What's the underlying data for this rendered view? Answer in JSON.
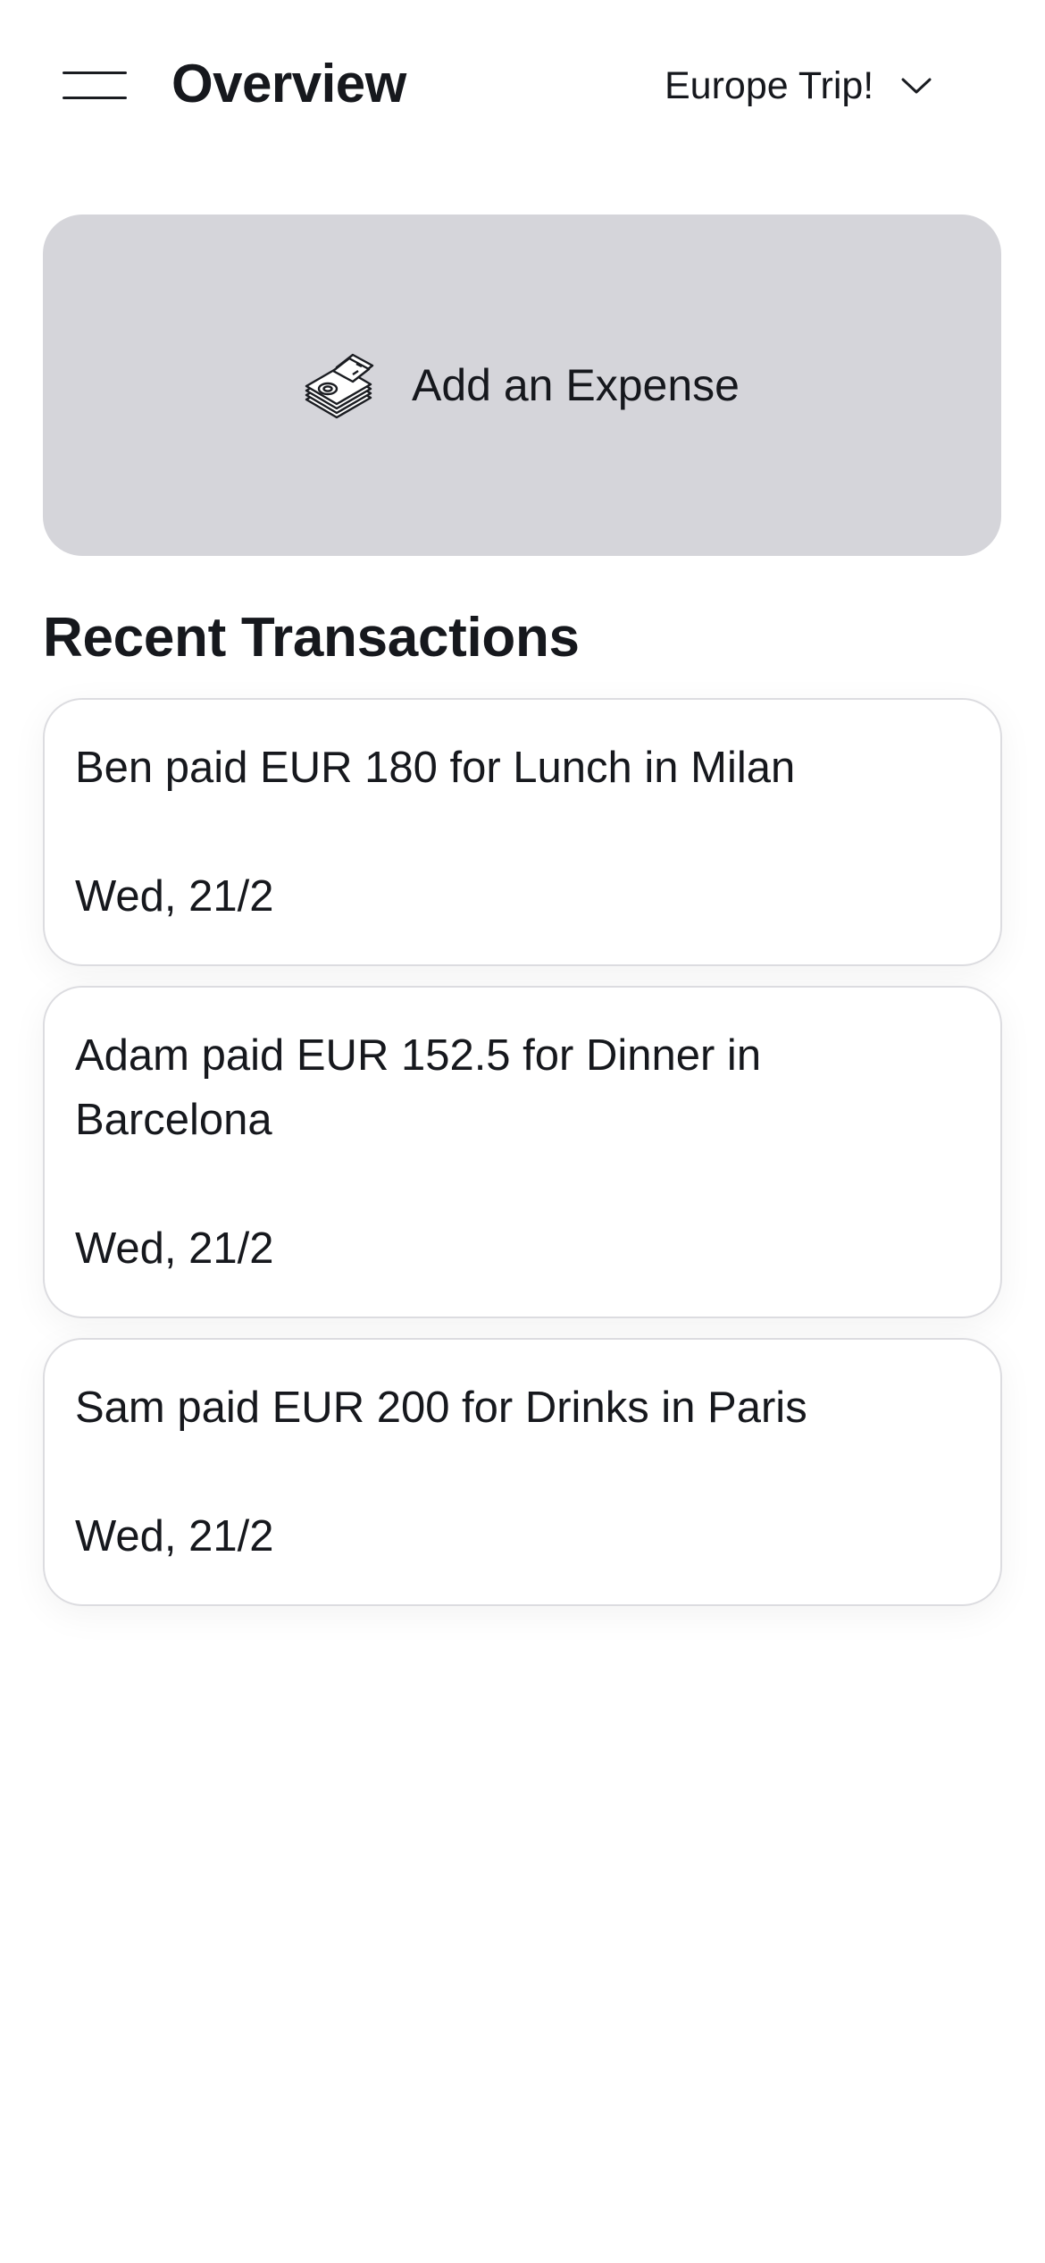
{
  "header": {
    "title": "Overview",
    "trip_selector": {
      "selected": "Europe Trip!"
    },
    "icons": {
      "menu": "menu-icon",
      "dropdown": "chevron-down-icon"
    }
  },
  "add_expense": {
    "label": "Add an Expense",
    "icon": "money-stack-icon"
  },
  "recent": {
    "title": "Recent Transactions",
    "transactions": [
      {
        "description": "Ben paid EUR 180 for Lunch in Milan",
        "date": "Wed, 21/2"
      },
      {
        "description": "Adam paid EUR 152.5 for Dinner in Barcelona",
        "date": "Wed, 21/2"
      },
      {
        "description": "Sam paid EUR 200 for Drinks in Paris",
        "date": "Wed, 21/2"
      }
    ]
  },
  "colors": {
    "text": "#16181d",
    "add_button_bg": "#d5d5da",
    "card_border": "#dcdce0",
    "background": "#ffffff"
  }
}
